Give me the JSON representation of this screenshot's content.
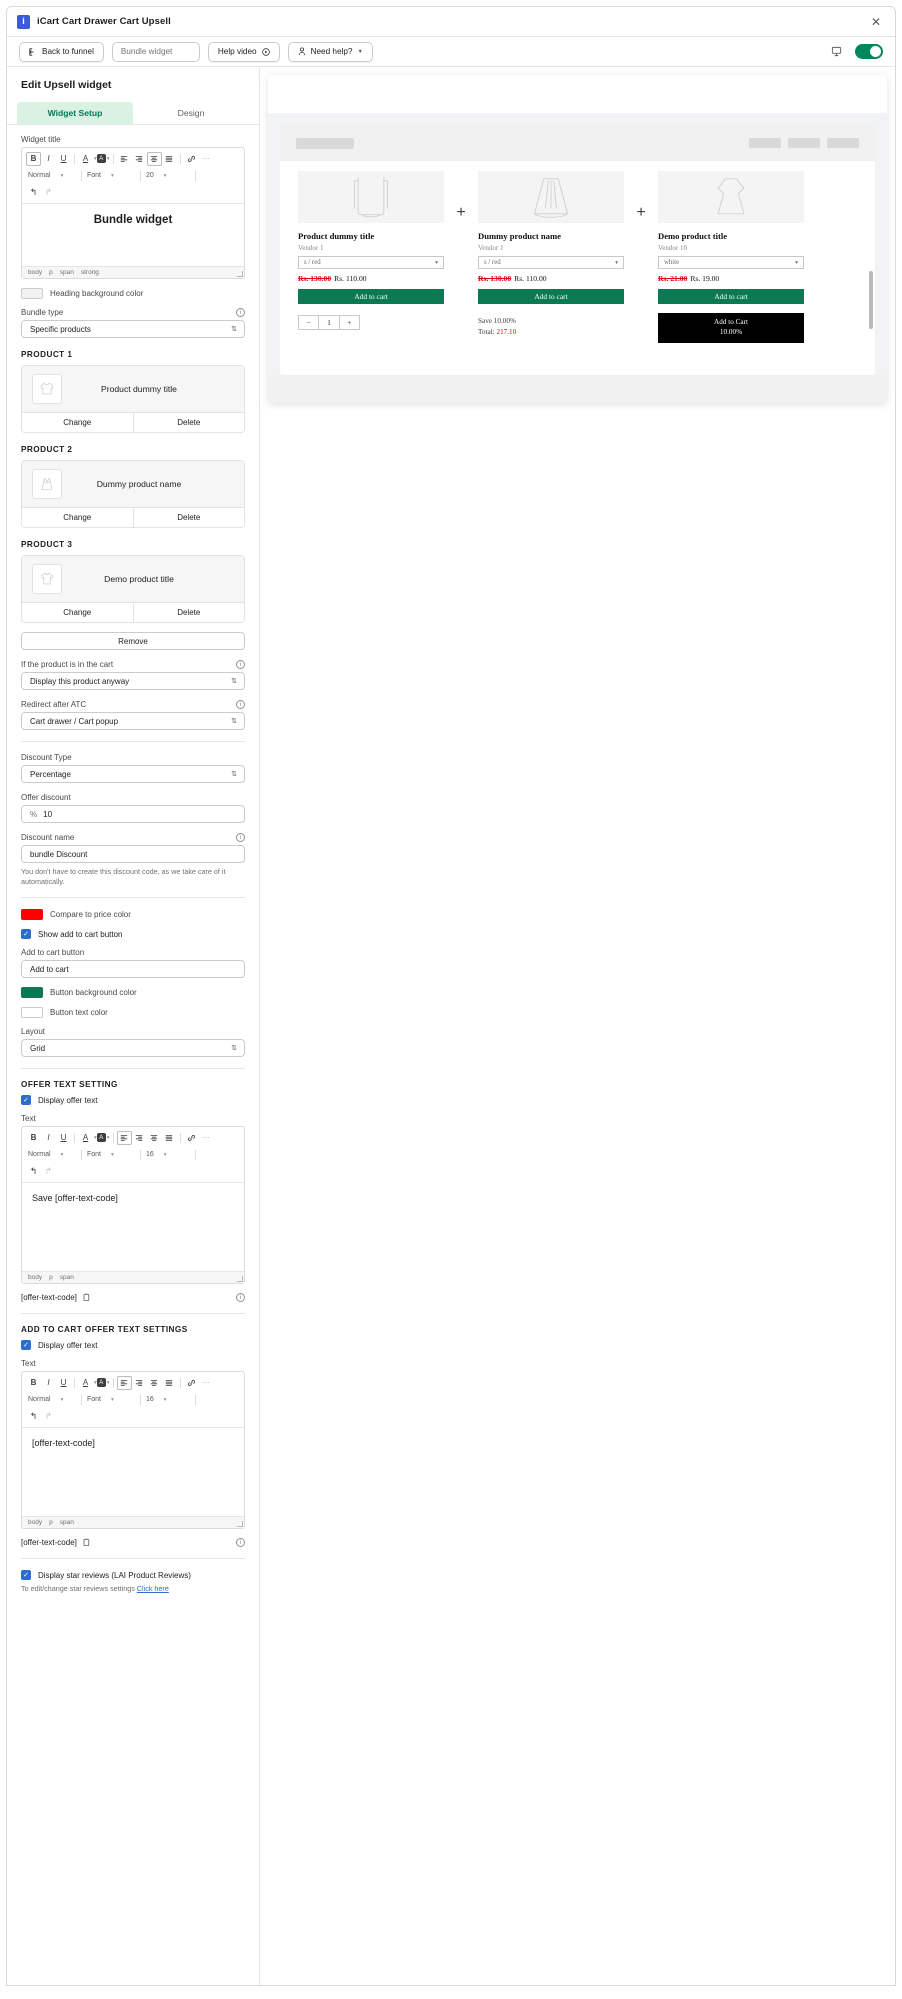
{
  "window": {
    "app_title": "iCart Cart Drawer Cart Upsell",
    "logo_glyph": "i",
    "close_label": "✕"
  },
  "toolbar": {
    "back_label": "Back to funnel",
    "widget_name_value": "Bundle widget",
    "widget_name_placeholder": "Bundle widget",
    "help_video_label": "Help video",
    "need_help_label": "Need help?"
  },
  "pane": {
    "title": "Edit Upsell widget",
    "tabs": [
      {
        "label": "Widget Setup",
        "active": true
      },
      {
        "label": "Design",
        "active": false
      }
    ]
  },
  "widget_title": {
    "label": "Widget title",
    "toolbar": {
      "bold": "B",
      "italic": "I",
      "underline": "U",
      "text_color": "A",
      "highlight": "A",
      "align_left": "▤",
      "align_center": "▤",
      "align_right": "▤",
      "align_justify": "▤",
      "link": "⛓",
      "more": "⋯",
      "undo": "↩",
      "redo": "↪",
      "style_value": "Normal",
      "font_value": "Font",
      "size_value": "20"
    },
    "content": "Bundle widget",
    "breadcrumb": [
      "body",
      "p",
      "span",
      "strong"
    ]
  },
  "heading_bg": {
    "label": "Heading background color",
    "color": "#f2f2f2"
  },
  "bundle_type": {
    "label": "Bundle type",
    "value": "Specific products"
  },
  "products": [
    {
      "section": "PRODUCT 1",
      "name": "Product dummy title",
      "icon": "shirt-icon",
      "change": "Change",
      "delete": "Delete"
    },
    {
      "section": "PRODUCT 2",
      "name": "Dummy product name",
      "icon": "dress-icon",
      "change": "Change",
      "delete": "Delete"
    },
    {
      "section": "PRODUCT 3",
      "name": "Demo product title",
      "icon": "tshirt-icon",
      "change": "Change",
      "delete": "Delete"
    }
  ],
  "remove_button": "Remove",
  "in_cart": {
    "label": "If the product is in the cart",
    "value": "Display this product anyway"
  },
  "redirect": {
    "label": "Redirect after ATC",
    "value": "Cart drawer / Cart popup"
  },
  "discount_type": {
    "label": "Discount Type",
    "value": "Percentage"
  },
  "offer_discount": {
    "label": "Offer discount",
    "prefix": "%",
    "value": "10"
  },
  "discount_name": {
    "label": "Discount name",
    "value": "bundle Discount",
    "help": "You don't have to create this discount code, as we take care of it automatically."
  },
  "compare_color": {
    "label": "Compare to price color",
    "color": "#ff0000"
  },
  "show_atc": {
    "label": "Show add to cart button",
    "checked": true
  },
  "atc_button": {
    "label": "Add to cart button",
    "value": "Add to cart"
  },
  "button_bg": {
    "label": "Button background color",
    "color": "#0b7a53"
  },
  "button_text_color": {
    "label": "Button text color",
    "color": "#ffffff"
  },
  "layout": {
    "label": "Layout",
    "value": "Grid"
  },
  "offer_text_setting": {
    "heading": "OFFER TEXT SETTING",
    "display_label": "Display offer text",
    "display_checked": true,
    "text_label": "Text",
    "toolbar": {
      "style_value": "Normal",
      "font_value": "Font",
      "size_value": "16"
    },
    "content": "Save [offer-text-code]",
    "breadcrumb": [
      "body",
      "p",
      "span"
    ],
    "code": "[offer-text-code]"
  },
  "atc_offer_text_setting": {
    "heading": "ADD TO CART OFFER TEXT SETTINGS",
    "display_label": "Display offer text",
    "display_checked": true,
    "text_label": "Text",
    "toolbar": {
      "style_value": "Normal",
      "font_value": "Font",
      "size_value": "16"
    },
    "content": "[offer-text-code]",
    "breadcrumb": [
      "body",
      "p",
      "span"
    ],
    "code": "[offer-text-code]"
  },
  "star_reviews": {
    "label": "Display star reviews (LAI Product Reviews)",
    "checked": true,
    "note_prefix": "To edit/change star reviews settings ",
    "note_link": "Click here"
  },
  "preview": {
    "plus_glyph": "+",
    "products": [
      {
        "title": "Product dummy title",
        "vendor": "Vendor 1",
        "variant": "s / red",
        "old_price": "Rs. 130.00",
        "new_price": "Rs. 110.00",
        "atc": "Add to cart",
        "icon": "sweater-icon"
      },
      {
        "title": "Dummy product name",
        "vendor": "Vendor 1",
        "variant": "s / red",
        "old_price": "Rs. 130.00",
        "new_price": "Rs. 110.00",
        "atc": "Add to cart",
        "icon": "skirt-icon"
      },
      {
        "title": "Demo product title",
        "vendor": "Vendor 10",
        "variant": "white",
        "old_price": "Rs. 21.00",
        "new_price": "Rs. 19.00",
        "atc": "Add to cart",
        "icon": "dress2-icon"
      }
    ],
    "qty": {
      "minus": "−",
      "value": "1",
      "plus": "+"
    },
    "save_text": "Save 10.00%",
    "total_label": "Total:",
    "total_value": "217.10",
    "bundle_button_line1": "Add to Cart",
    "bundle_button_line2": "10.00%"
  }
}
